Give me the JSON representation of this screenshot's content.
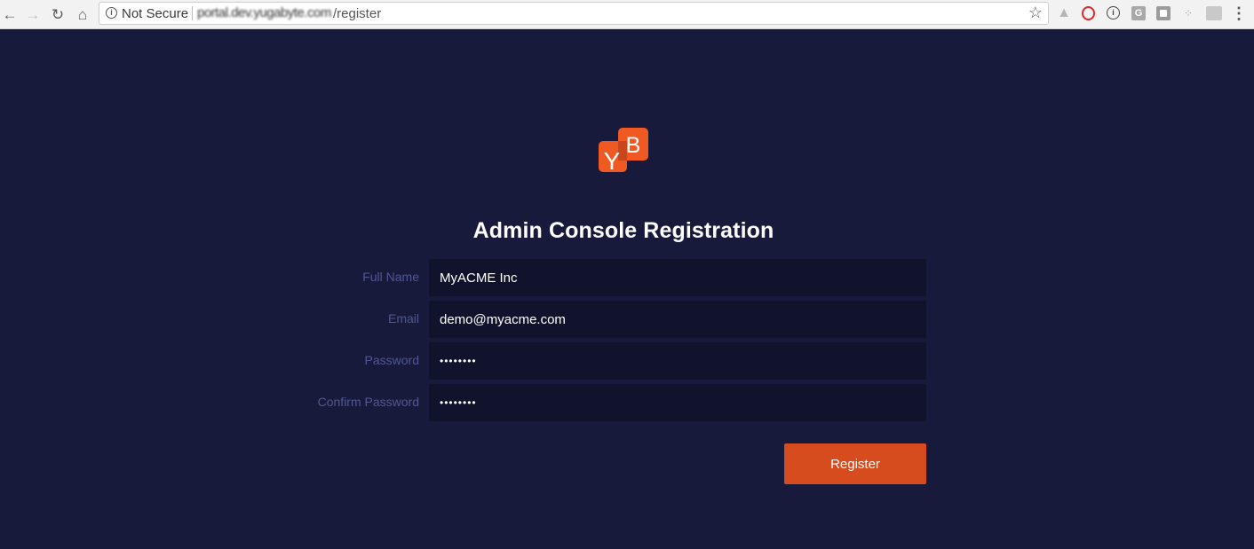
{
  "browser": {
    "security_label": "Not Secure",
    "url_host": "portal.dev.yugabyte.com",
    "url_path": "/register"
  },
  "brand": {
    "logo_letters": [
      "Y",
      "B"
    ],
    "accent_color": "#f05a22"
  },
  "page": {
    "title": "Admin Console Registration"
  },
  "form": {
    "fields": [
      {
        "label": "Full Name",
        "value": "MyACME Inc",
        "type": "text"
      },
      {
        "label": "Email",
        "value": "demo@myacme.com",
        "type": "email"
      },
      {
        "label": "Password",
        "value": "••••••••",
        "type": "password"
      },
      {
        "label": "Confirm Password",
        "value": "••••••••",
        "type": "password"
      }
    ],
    "submit_label": "Register"
  },
  "colors": {
    "background": "#171a3b",
    "input_background": "#11132d",
    "label": "#515794",
    "button": "#d64c1f"
  }
}
